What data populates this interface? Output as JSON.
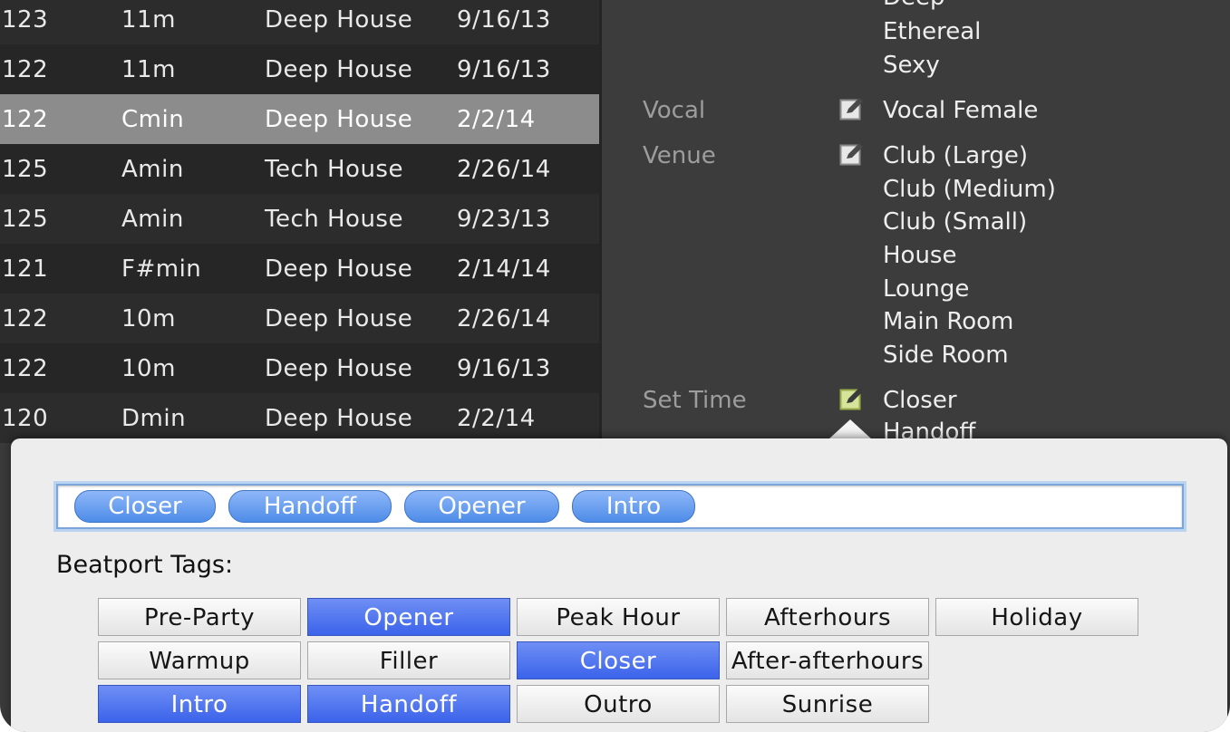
{
  "tracks": [
    {
      "bpm": "123",
      "key": "11m",
      "genre": "Deep House",
      "date": "9/16/13"
    },
    {
      "bpm": "122",
      "key": "11m",
      "genre": "Deep House",
      "date": "9/16/13"
    },
    {
      "bpm": "122",
      "key": "Cmin",
      "genre": "Deep House",
      "date": "2/2/14"
    },
    {
      "bpm": "125",
      "key": "Amin",
      "genre": "Tech House",
      "date": "2/26/14"
    },
    {
      "bpm": "125",
      "key": "Amin",
      "genre": "Tech House",
      "date": "9/23/13"
    },
    {
      "bpm": "121",
      "key": "F#min",
      "genre": "Deep House",
      "date": "2/14/14"
    },
    {
      "bpm": "122",
      "key": "10m",
      "genre": "Deep House",
      "date": "2/26/14"
    },
    {
      "bpm": "122",
      "key": "10m",
      "genre": "Deep House",
      "date": "9/16/13"
    },
    {
      "bpm": "120",
      "key": "Dmin",
      "genre": "Deep House",
      "date": "2/2/14"
    }
  ],
  "selected_track_index": 2,
  "details": {
    "mood_values": [
      "Deep",
      "Ethereal",
      "Sexy"
    ],
    "vocal_label": "Vocal",
    "vocal_values": [
      "Vocal Female"
    ],
    "venue_label": "Venue",
    "venue_values": [
      "Club (Large)",
      "Club (Medium)",
      "Club (Small)",
      "House",
      "Lounge",
      "Main Room",
      "Side Room"
    ],
    "settime_label": "Set Time",
    "settime_values": [
      "Closer",
      "Handoff"
    ]
  },
  "popover": {
    "tokens": [
      "Closer",
      "Handoff",
      "Opener",
      "Intro"
    ],
    "tags_label": "Beatport Tags:",
    "tags": [
      {
        "label": "Pre-Party",
        "on": false
      },
      {
        "label": "Opener",
        "on": true
      },
      {
        "label": "Peak Hour",
        "on": false
      },
      {
        "label": "Afterhours",
        "on": false
      },
      {
        "label": "Holiday",
        "on": false
      },
      {
        "label": "Warmup",
        "on": false
      },
      {
        "label": "Filler",
        "on": false
      },
      {
        "label": "Closer",
        "on": true
      },
      {
        "label": "After-afterhours",
        "on": false
      },
      {
        "label": "Intro",
        "on": true
      },
      {
        "label": "Handoff",
        "on": true
      },
      {
        "label": "Outro",
        "on": false
      },
      {
        "label": "Sunrise",
        "on": false
      }
    ]
  },
  "colors": {
    "selected_row": "#8c8c8c",
    "tag_on": "#4a6ff0",
    "token": "#5b95ee",
    "edit_icon_active": "#d6e39a"
  },
  "icons": {
    "edit": "edit-icon"
  }
}
